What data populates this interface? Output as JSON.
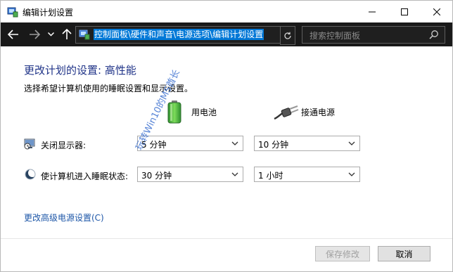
{
  "window": {
    "title": "编辑计划设置",
    "controls": {
      "minimize": "minimize-icon",
      "maximize": "maximize-icon",
      "close": "close-icon"
    }
  },
  "navigation": {
    "address_path": "控制面板\\硬件和声音\\电源选项\\编辑计划设置",
    "search_placeholder": "搜索控制面板"
  },
  "main": {
    "heading": "更改计划的设置: 高性能",
    "description": "选择希望计算机使用的睡眠设置和显示设置。",
    "columns": {
      "battery": "用电池",
      "plugged_in": "接通电源"
    },
    "rows": [
      {
        "label": "关闭显示器:",
        "on_battery": "5 分钟",
        "plugged_in": "10 分钟",
        "icon": "display-timer-icon"
      },
      {
        "label": "使计算机进入睡眠状态:",
        "on_battery": "30 分钟",
        "plugged_in": "1 小时",
        "icon": "sleep-moon-icon"
      }
    ],
    "advanced_link": "更改高级电源设置(C)"
  },
  "footer": {
    "save_label": "保存修改",
    "cancel_label": "取消"
  },
  "watermark": "玩转Win10的MS酋长",
  "colors": {
    "accent": "#0078d7",
    "heading": "#1e3287",
    "link": "#1e57a8",
    "navbar": "#191919"
  }
}
